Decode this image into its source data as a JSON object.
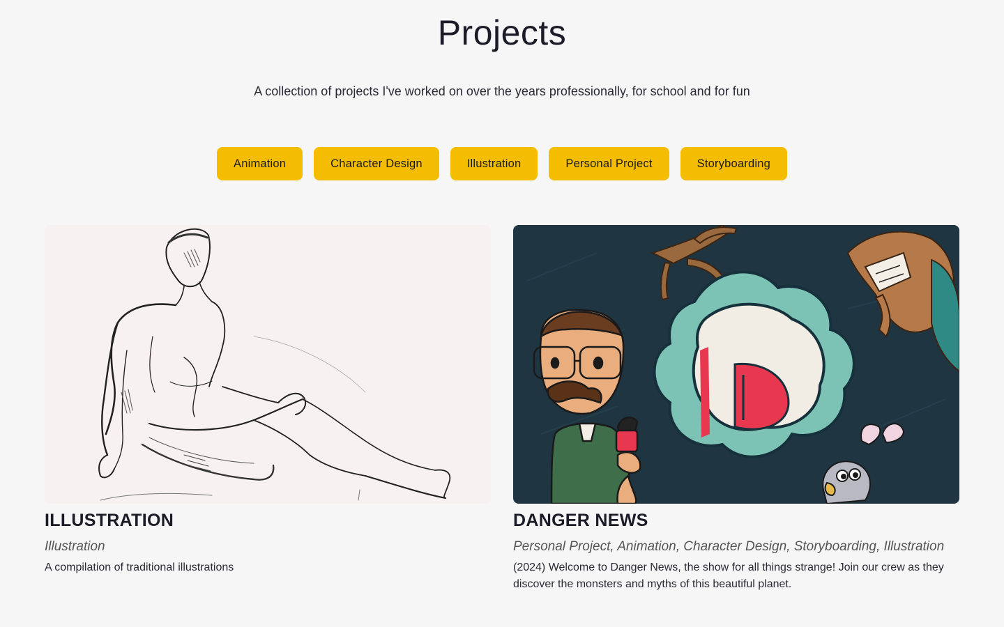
{
  "header": {
    "title": "Projects",
    "subtitle": "A collection of projects I've worked on over the years professionally, for school and for fun"
  },
  "filters": [
    {
      "label": "Animation"
    },
    {
      "label": "Character Design"
    },
    {
      "label": "Illustration"
    },
    {
      "label": "Personal Project"
    },
    {
      "label": "Storyboarding"
    }
  ],
  "projects": [
    {
      "title": "ILLUSTRATION",
      "categories": "Illustration",
      "description": "A compilation of traditional illustrations",
      "image": "figure-drawing-sketch"
    },
    {
      "title": "DANGER NEWS",
      "categories": "Personal Project, Animation, Character Design, Storyboarding, Illustration",
      "description": "(2024) Welcome to Danger News, the show for all things strange! Join our crew as they discover the monsters and myths of this beautiful planet.",
      "image": "danger-news-cartoon-key-art"
    }
  ],
  "colors": {
    "background": "#f6f6f6",
    "filter_button": "#f5bd02",
    "danger_news_bg": "#1f3542",
    "logo_teal": "#7cc3b6",
    "logo_red": "#e8384f"
  }
}
